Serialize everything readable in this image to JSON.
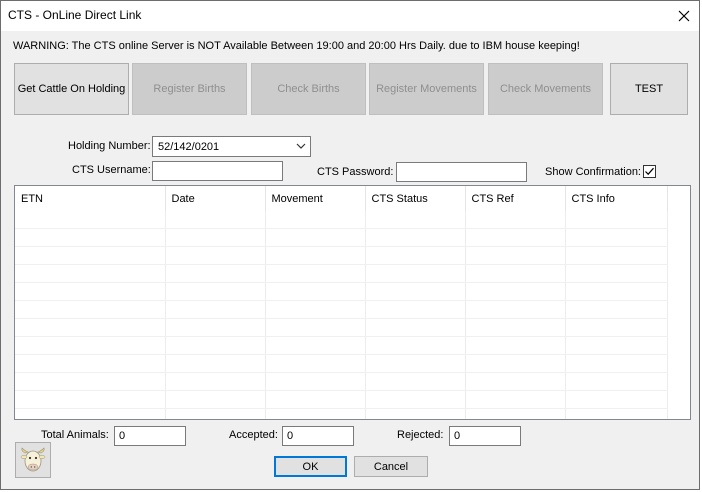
{
  "window": {
    "title": "CTS - OnLine Direct Link",
    "close_icon": "close-icon"
  },
  "warning": "WARNING: The CTS online Server is NOT Available Between 19:00 and 20:00 Hrs Daily. due to IBM house keeping!",
  "toolbar": {
    "get_cattle": "Get Cattle On Holding",
    "register_births": "Register Births",
    "check_births": "Check Births",
    "register_movements": "Register Movements",
    "check_movements": "Check Movements",
    "test": "TEST"
  },
  "form": {
    "holding_label": "Holding Number:",
    "holding_value": "52/142/0201",
    "username_label": "CTS Username:",
    "username_value": "",
    "password_label": "CTS Password:",
    "password_value": "",
    "show_confirmation_label": "Show Confirmation:",
    "show_confirmation_checked": true
  },
  "grid": {
    "columns": [
      "ETN",
      "Date",
      "Movement",
      "CTS Status",
      "CTS Ref",
      "CTS Info"
    ],
    "rows": []
  },
  "totals": {
    "total_label": "Total Animals:",
    "total_value": "0",
    "accepted_label": "Accepted:",
    "accepted_value": "0",
    "rejected_label": "Rejected:",
    "rejected_value": "0"
  },
  "footer": {
    "ok": "OK",
    "cancel": "Cancel",
    "cow_icon": "cow-icon"
  }
}
